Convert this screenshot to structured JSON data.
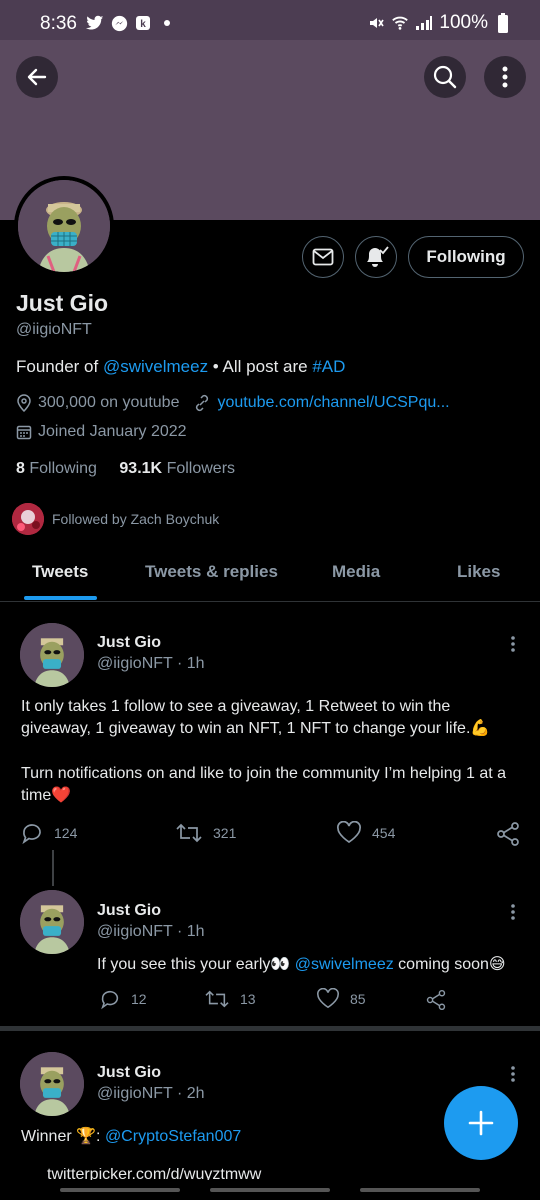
{
  "status": {
    "time": "8:36",
    "battery": "100%"
  },
  "colors": {
    "accent": "#1d9bf0",
    "banner": "#5b4a5f",
    "like_heart": "#e0245e"
  },
  "header": {
    "back_icon": "back-arrow-icon",
    "search_icon": "search-icon",
    "more_icon": "more-vertical-icon"
  },
  "profile": {
    "name": "Just Gio",
    "handle": "@iigioNFT",
    "bio_prefix": "Founder of ",
    "bio_mention": "@swivelmeez",
    "bio_sep": " • All post are ",
    "bio_hashtag": "#AD",
    "location": "300,000 on youtube",
    "link": "youtube.com/channel/UCSPqu...",
    "joined": "Joined January 2022",
    "following_count": "8",
    "following_label": "Following",
    "followers_count": "93.1K",
    "followers_label": "Followers",
    "followed_by": "Followed by Zach Boychuk",
    "follow_button": "Following"
  },
  "tabs": [
    {
      "label": "Tweets",
      "active": true
    },
    {
      "label": "Tweets & replies"
    },
    {
      "label": "Media"
    },
    {
      "label": "Likes"
    }
  ],
  "tweets": [
    {
      "name": "Just Gio",
      "handle": "@iigioNFT · 1h",
      "text1": "It only takes 1 follow to see a giveaway, 1 Retweet to win the giveaway, 1 giveaway to win an NFT, 1 NFT to change your life.💪",
      "text2": "Turn notifications on and like to join the community I’m helping 1 at a time❤️",
      "replies": "124",
      "retweets": "321",
      "likes": "454"
    },
    {
      "name": "Just Gio",
      "handle": "@iigioNFT · 1h",
      "text_prefix": "If you see this your early👀 ",
      "text_mention": "@swivelmeez",
      "text_suffix": " coming soon😅",
      "replies": "12",
      "retweets": "13",
      "likes": "85"
    },
    {
      "name": "Just Gio",
      "handle": "@iigioNFT · 2h",
      "text_prefix": "Winner 🏆: ",
      "text_mention": "@CryptoStefan007",
      "link_partial": "twitterpicker.com/d/wuyztmww"
    }
  ]
}
